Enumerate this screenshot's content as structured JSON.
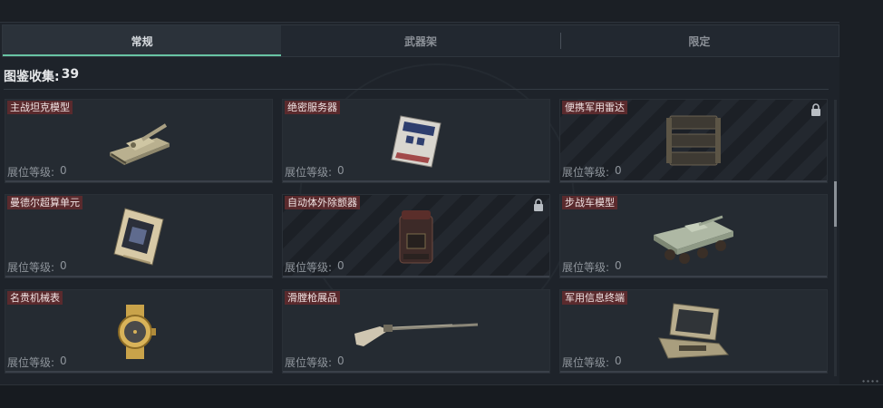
{
  "tabs": [
    {
      "label": "常规",
      "active": true
    },
    {
      "label": "武器架",
      "active": false
    },
    {
      "label": "限定",
      "active": false
    }
  ],
  "collection": {
    "label": "图鉴收集:",
    "count": "39"
  },
  "level_label": "展位等级:",
  "items": [
    {
      "name": "主战坦克模型",
      "level": "0",
      "locked": false,
      "icon": "tank-model-icon"
    },
    {
      "name": "绝密服务器",
      "level": "0",
      "locked": false,
      "icon": "server-icon"
    },
    {
      "name": "便携军用雷达",
      "level": "0",
      "locked": true,
      "icon": "radar-icon"
    },
    {
      "name": "曼德尔超算单元",
      "level": "0",
      "locked": false,
      "icon": "supercomputer-icon"
    },
    {
      "name": "自动体外除颤器",
      "level": "0",
      "locked": true,
      "icon": "defibrillator-icon"
    },
    {
      "name": "步战车模型",
      "level": "0",
      "locked": false,
      "icon": "ifv-model-icon"
    },
    {
      "name": "名贵机械表",
      "level": "0",
      "locked": false,
      "icon": "watch-icon"
    },
    {
      "name": "滑膛枪展品",
      "level": "0",
      "locked": false,
      "icon": "musket-icon"
    },
    {
      "name": "军用信息终端",
      "level": "0",
      "locked": false,
      "icon": "terminal-icon"
    }
  ],
  "colors": {
    "accent": "#68c4a3",
    "name_bg": "#5a2a2d"
  }
}
